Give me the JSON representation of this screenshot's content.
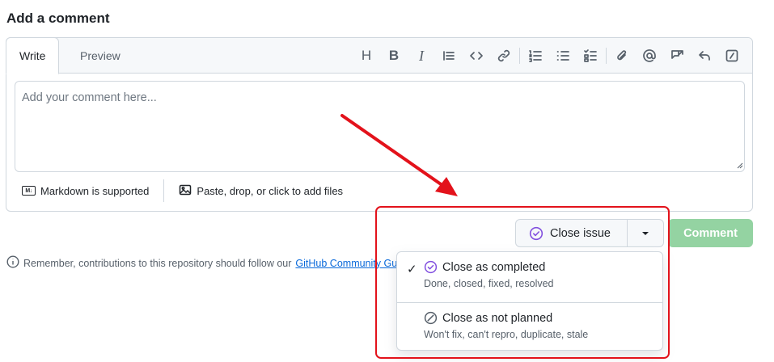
{
  "heading": "Add a comment",
  "tabs": [
    {
      "label": "Write"
    },
    {
      "label": "Preview"
    }
  ],
  "toolbar": {
    "heading_label": "H",
    "bold_label": "B",
    "italic_label": "I"
  },
  "textarea": {
    "placeholder": "Add your comment here...",
    "value": ""
  },
  "footer": {
    "markdown_badge": "M↓",
    "markdown_label": "Markdown is supported",
    "attach_label": "Paste, drop, or click to add files"
  },
  "actions": {
    "close_issue_label": "Close issue",
    "comment_label": "Comment"
  },
  "notice": {
    "text": "Remember, contributions to this repository should follow our",
    "link": "GitHub Community Guidelines"
  },
  "dropdown": {
    "items": [
      {
        "title": "Close as completed",
        "desc": "Done, closed, fixed, resolved",
        "selected": true
      },
      {
        "title": "Close as not planned",
        "desc": "Won't fix, can't repro, duplicate, stale",
        "selected": false
      }
    ]
  },
  "colors": {
    "accent_purple": "#8250df",
    "comment_button_disabled": "#94d3a2",
    "annotation_red": "#e3121b",
    "link_blue": "#0969da"
  }
}
